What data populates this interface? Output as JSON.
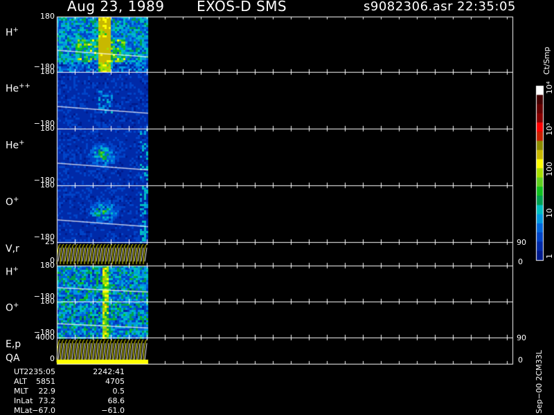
{
  "header": {
    "date": "Aug 23, 1989",
    "instrument": "EXOS-D SMS",
    "file": "s9082306.asr",
    "time": "22:35:05"
  },
  "panels": [
    {
      "label": "H",
      "sup": "+",
      "top": "180",
      "bottom": "−180"
    },
    {
      "label": "He",
      "sup": "++",
      "top": "180",
      "bottom": "−180"
    },
    {
      "label": "He",
      "sup": "+",
      "top": "180",
      "bottom": "−180"
    },
    {
      "label": "O",
      "sup": "+",
      "top": "180",
      "bottom": "−180"
    },
    {
      "label": "V,r",
      "sup": "",
      "top": "25",
      "bottom": "0",
      "right_top": "90",
      "right_bottom": "0"
    },
    {
      "label": "H",
      "sup": "+",
      "top": "180",
      "bottom": "−180"
    },
    {
      "label": "O",
      "sup": "+",
      "top": "180",
      "bottom": "−180"
    },
    {
      "label": "E,p",
      "sup": "",
      "label2": "QA",
      "top": "4000",
      "bottom": "0",
      "right_top": "90",
      "right_bottom": "0"
    }
  ],
  "colorbar": {
    "unit": "Ct/Smp",
    "ticks": [
      "1",
      "10",
      "100",
      "10³",
      "10⁴"
    ],
    "colors": [
      "#001a8c",
      "#002aa8",
      "#0044c8",
      "#0066dd",
      "#0099e0",
      "#00c0c0",
      "#00a050",
      "#10c020",
      "#60d020",
      "#a8e000",
      "#ffff00",
      "#c8b800",
      "#8c8c00",
      "#c82000",
      "#ff0000",
      "#880000",
      "#660000",
      "#440000",
      "#ffffff"
    ]
  },
  "footer": {
    "rows": [
      {
        "name": "UT",
        "v1": "2235:05",
        "v2": "2242:41"
      },
      {
        "name": "ALT",
        "v1": "5851",
        "v2": "4705"
      },
      {
        "name": "MLT",
        "v1": "22.9",
        "v2": "0.5"
      },
      {
        "name": "InLat",
        "v1": "73.2",
        "v2": "68.6"
      },
      {
        "name": "MLat",
        "v1": "−67.0",
        "v2": "−61.0"
      }
    ],
    "side_text": "Sep−00 2CM33L"
  }
}
